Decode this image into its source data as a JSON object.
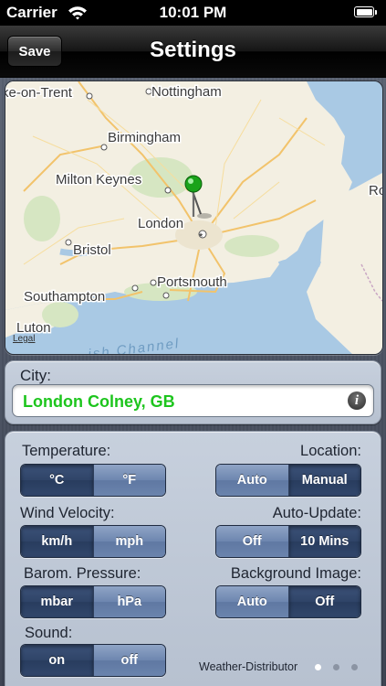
{
  "status": {
    "carrier": "Carrier",
    "time": "10:01 PM"
  },
  "nav": {
    "title": "Settings",
    "save": "Save"
  },
  "map": {
    "legal": "Legal",
    "places": [
      "ke-on-Trent",
      "Nottingham",
      "Birmingham",
      "Milton Keynes",
      "London",
      "Bristol",
      "Portsmouth",
      "Southampton",
      "Luton",
      "Ro"
    ],
    "sea_label": "ish Channel"
  },
  "city": {
    "label": "City:",
    "value": "London Colney, GB"
  },
  "settings": {
    "temperature": {
      "label": "Temperature:",
      "options": [
        "°C",
        "°F"
      ],
      "selected": 0
    },
    "location": {
      "label": "Location:",
      "options": [
        "Auto",
        "Manual"
      ],
      "selected": 1
    },
    "wind": {
      "label": "Wind Velocity:",
      "options": [
        "km/h",
        "mph"
      ],
      "selected": 0
    },
    "autoupdate": {
      "label": "Auto-Update:",
      "options": [
        "Off",
        "10 Mins"
      ],
      "selected": 1
    },
    "pressure": {
      "label": "Barom. Pressure:",
      "options": [
        "mbar",
        "hPa"
      ],
      "selected": 0
    },
    "background": {
      "label": "Background Image:",
      "options": [
        "Auto",
        "Off"
      ],
      "selected": 1
    },
    "sound": {
      "label": "Sound:",
      "options": [
        "on",
        "off"
      ],
      "selected": 0
    }
  },
  "footer": {
    "text": "Weather-Distributor",
    "pages": 3,
    "current": 0
  }
}
